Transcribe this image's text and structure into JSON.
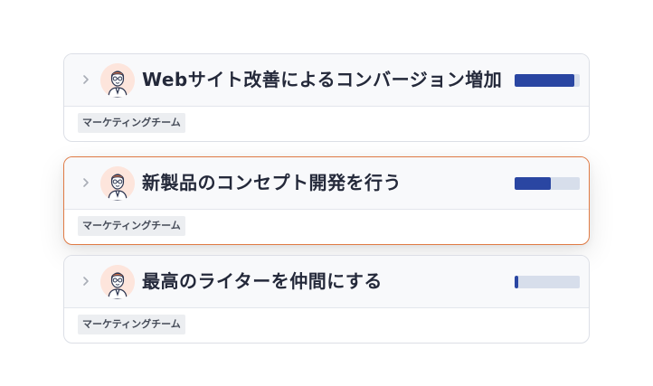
{
  "goals": [
    {
      "title": "Webサイト改善によるコンバージョン増加",
      "team": "マーケティングチーム",
      "progress": 0.92,
      "highlighted": false,
      "avatar_icon": "person-with-glasses-icon"
    },
    {
      "title": "新製品のコンセプト開発を行う",
      "team": "マーケティングチーム",
      "progress": 0.56,
      "highlighted": true,
      "avatar_icon": "person-with-glasses-icon"
    },
    {
      "title": "最高のライターを仲間にする",
      "team": "マーケティングチーム",
      "progress": 0.06,
      "highlighted": false,
      "avatar_icon": "person-with-glasses-icon"
    }
  ],
  "colors": {
    "progress_fill": "#2a46a2",
    "progress_track": "#d7deeb",
    "highlight_border": "#e07b45"
  }
}
